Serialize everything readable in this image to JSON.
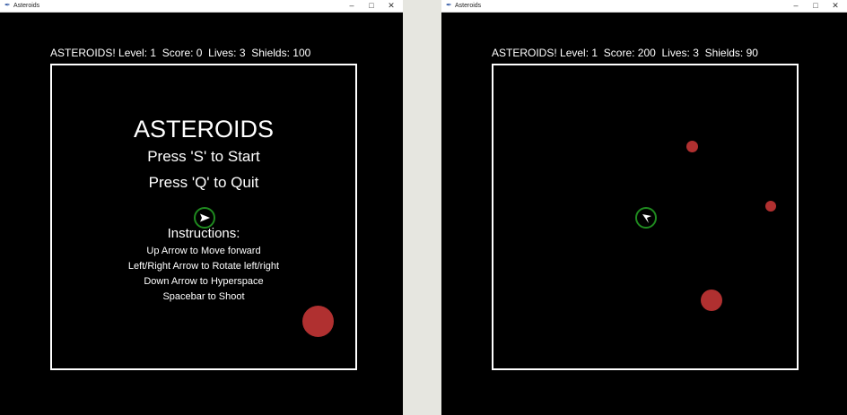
{
  "windows": [
    {
      "title": "Asteroids",
      "status": {
        "prefix": "ASTEROIDS!",
        "level_label": "Level:",
        "level": "1",
        "score_label": "Score:",
        "score": "0",
        "lives_label": "Lives:",
        "lives": "3",
        "shields_label": "Shields:",
        "shields": "100"
      },
      "menu": {
        "title": "ASTEROIDS",
        "start": "Press 'S' to Start",
        "quit": "Press 'Q' to Quit",
        "instructions_heading": "Instructions:",
        "instructions": [
          "Up Arrow to Move forward",
          "Left/Right Arrow to Rotate left/right",
          "Down Arrow to Hyperspace",
          "Spacebar to Shoot"
        ]
      }
    },
    {
      "title": "Asteroids",
      "status": {
        "prefix": "ASTEROIDS!",
        "level_label": "Level:",
        "level": "1",
        "score_label": "Score:",
        "score": "200",
        "lives_label": "Lives:",
        "lives": "3",
        "shields_label": "Shields:",
        "shields": "90"
      }
    }
  ],
  "colors": {
    "field_border": "#ffffff",
    "ship": "#ffffff",
    "shield_ring": "#1f8a1f",
    "asteroid": "#b03030",
    "background": "#000000"
  },
  "icons": {
    "app": "feather-icon",
    "minimize": "minimize-icon",
    "maximize": "maximize-icon",
    "close": "close-icon"
  }
}
